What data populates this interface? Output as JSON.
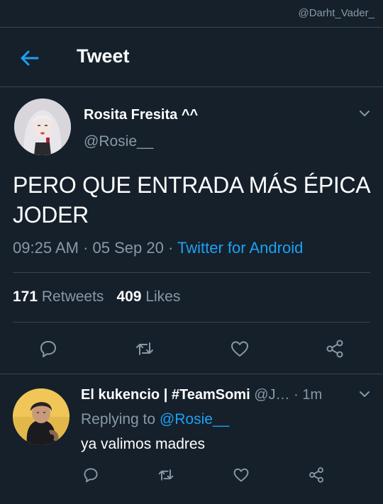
{
  "watermark": "@Darht_Vader_",
  "header": {
    "title": "Tweet"
  },
  "tweet": {
    "author_name": "Rosita Fresita ^^",
    "author_handle": "@Rosie__",
    "text": "PERO QUE ENTRADA MÁS ÉPICA JODER",
    "time": "09:25 AM",
    "date": "05 Sep 20",
    "sep": "·",
    "source": "Twitter for Android",
    "retweets_count": "171",
    "retweets_label": "Retweets",
    "likes_count": "409",
    "likes_label": "Likes"
  },
  "reply": {
    "author_name": "El kukencio | #TeamSomi",
    "author_handle": "@J…",
    "sep": "·",
    "age": "1m",
    "replying_prefix": "Replying to",
    "replying_to": "@Rosie__",
    "text": "ya valimos madres"
  },
  "icons": {
    "back": "arrow-left-icon",
    "menu": "chevron-down-icon",
    "reply": "speech-bubble-icon",
    "retweet": "retweet-icon",
    "like": "heart-icon",
    "share": "share-icon"
  },
  "colors": {
    "background": "#15202b",
    "accent": "#1da1f2",
    "muted": "#8899a6",
    "divider": "#38444d"
  }
}
